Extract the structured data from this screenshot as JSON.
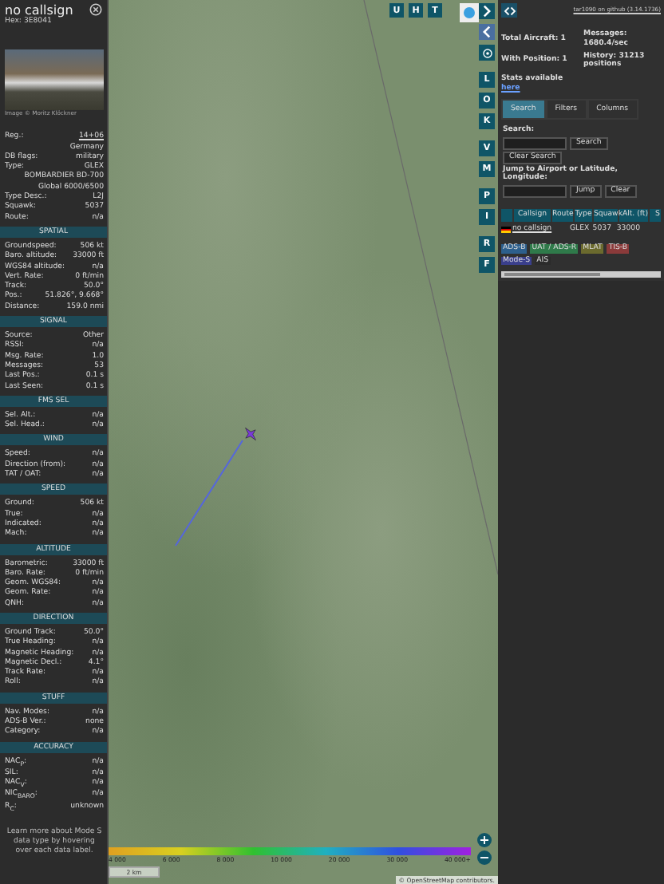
{
  "aircraft": {
    "callsign": "no callsign",
    "hex_label": "Hex:",
    "hex": "3E8041",
    "photo_credit": "Image © Moritz Klöckner",
    "info_rows": [
      {
        "label": "Reg.:",
        "value": "14+06",
        "link": true
      },
      {
        "label": "",
        "value": "Germany",
        "link": false
      },
      {
        "label": "DB flags:",
        "value": "military",
        "link": false
      },
      {
        "label": "Type:",
        "value": "GLEX",
        "link": false
      },
      {
        "label": "",
        "value": "BOMBARDIER BD-700 Global 6000/6500",
        "link": false
      },
      {
        "label": "Type Desc.:",
        "value": "L2J",
        "link": false
      },
      {
        "label": "Squawk:",
        "value": "5037",
        "link": false
      },
      {
        "label": "Route:",
        "value": "n/a",
        "link": false
      }
    ],
    "sections": [
      {
        "title": "SPATIAL",
        "rows": [
          {
            "label": "Groundspeed:",
            "value": "506 kt"
          },
          {
            "label": "Baro. altitude:",
            "value": "33000 ft"
          },
          {
            "label": "WGS84 altitude:",
            "value": "n/a"
          },
          {
            "label": "Vert. Rate:",
            "value": "0 ft/min"
          },
          {
            "label": "Track:",
            "value": "50.0°"
          },
          {
            "label": "Pos.:",
            "value": "51.826°, 9.668°"
          },
          {
            "label": "Distance:",
            "value": "159.0 nmi"
          }
        ]
      },
      {
        "title": "SIGNAL",
        "rows": [
          {
            "label": "Source:",
            "value": "Other"
          },
          {
            "label": "RSSI:",
            "value": "n/a"
          },
          {
            "label": "Msg. Rate:",
            "value": "1.0"
          },
          {
            "label": "Messages:",
            "value": "53"
          },
          {
            "label": "Last Pos.:",
            "value": "0.1 s"
          },
          {
            "label": "Last Seen:",
            "value": "0.1 s"
          }
        ]
      },
      {
        "title": "FMS SEL",
        "rows": [
          {
            "label": "Sel. Alt.:",
            "value": "n/a"
          },
          {
            "label": "Sel. Head.:",
            "value": "n/a"
          }
        ]
      },
      {
        "title": "WIND",
        "rows": [
          {
            "label": "Speed:",
            "value": "n/a"
          },
          {
            "label": "Direction (from):",
            "value": "n/a"
          },
          {
            "label": "TAT / OAT:",
            "value": "n/a"
          }
        ]
      },
      {
        "title": "SPEED",
        "rows": [
          {
            "label": "Ground:",
            "value": "506 kt"
          },
          {
            "label": "True:",
            "value": "n/a"
          },
          {
            "label": "Indicated:",
            "value": "n/a"
          },
          {
            "label": "Mach:",
            "value": "n/a"
          }
        ]
      },
      {
        "title": "ALTITUDE",
        "rows": [
          {
            "label": "Barometric:",
            "value": "33000 ft"
          },
          {
            "label": "Baro. Rate:",
            "value": "0 ft/min"
          },
          {
            "label": "Geom. WGS84:",
            "value": "n/a"
          },
          {
            "label": "Geom. Rate:",
            "value": "n/a"
          },
          {
            "label": "QNH:",
            "value": "n/a"
          }
        ]
      },
      {
        "title": "DIRECTION",
        "rows": [
          {
            "label": "Ground Track:",
            "value": "50.0°"
          },
          {
            "label": "True Heading:",
            "value": "n/a"
          },
          {
            "label": "Magnetic Heading:",
            "value": "n/a"
          },
          {
            "label": "Magnetic Decl.:",
            "value": "4.1°"
          },
          {
            "label": "Track Rate:",
            "value": "n/a"
          },
          {
            "label": "Roll:",
            "value": "n/a"
          }
        ]
      },
      {
        "title": "STUFF",
        "rows": [
          {
            "label": "Nav. Modes:",
            "value": "n/a"
          },
          {
            "label": "ADS-B Ver.:",
            "value": "none"
          },
          {
            "label": "Category:",
            "value": "n/a"
          }
        ]
      },
      {
        "title": "ACCURACY",
        "rows": [
          {
            "label": "NAC$_{P}$:",
            "value": "n/a"
          },
          {
            "label": "SIL:",
            "value": "n/a"
          },
          {
            "label": "NAC$_{V}$:",
            "value": "n/a"
          },
          {
            "label": "NIC$_{BARO}$:",
            "value": "n/a"
          },
          {
            "label": "R$_{C}$:",
            "value": "unknown"
          }
        ]
      }
    ],
    "footer_note": "Learn more about Mode S data type by hovering over each data label."
  },
  "map": {
    "top_buttons": [
      "U",
      "H",
      "T"
    ],
    "side_buttons": [
      [
        "L",
        "O",
        "K"
      ],
      [
        "V",
        "M"
      ],
      [
        "P",
        "I"
      ],
      [
        "R",
        "F"
      ]
    ],
    "altitude_legend": [
      "4 000",
      "6 000",
      "8 000",
      "10 000",
      "20 000",
      "30 000",
      "40 000+"
    ],
    "scale": "2 km",
    "zoom_in": "+",
    "zoom_out": "−",
    "attribution": "© OpenStreetMap contributors."
  },
  "panel": {
    "version_link": "tar1090 on github (3.14.1736)",
    "stats": [
      {
        "label": "Total Aircraft: 1"
      },
      {
        "label": "With Position: 1"
      },
      {
        "label": "Messages: 1680.4/sec"
      },
      {
        "label": "History: 31213 positions"
      }
    ],
    "stats_text": "Stats available",
    "stats_link": "here",
    "tabs": [
      {
        "label": "Search",
        "selected": true
      },
      {
        "label": "Filters",
        "selected": false
      },
      {
        "label": "Columns",
        "selected": false
      }
    ],
    "search_label": "Search:",
    "search_button": "Search",
    "clear_search": "Clear Search",
    "jump_label": "Jump to Airport or Latitude, Longitude:",
    "jump_button": "Jump",
    "clear_button": "Clear",
    "columns": [
      "Callsign",
      "Route",
      "Type",
      "Squawk",
      "Alt. (ft)",
      "S"
    ],
    "rows": [
      {
        "callsign": "no callsign",
        "type": "GLEX",
        "squawk": "5037",
        "altitude": "33000"
      }
    ],
    "sources": [
      {
        "label": "ADS-B",
        "color": "#2d5f8c"
      },
      {
        "label": "UAT / ADS-R",
        "color": "#2f7a4a"
      },
      {
        "label": "MLAT",
        "color": "#6b6a2e"
      },
      {
        "label": "TIS-B",
        "color": "#8a3a3a"
      },
      {
        "label": "Mode-S",
        "color": "#3a3f8c"
      },
      {
        "label": "AIS",
        "color": "#2b2b2b"
      }
    ]
  }
}
